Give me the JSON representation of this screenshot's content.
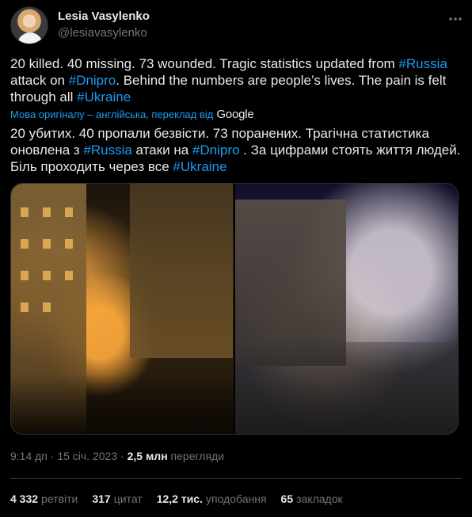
{
  "author": {
    "name": "Lesia Vasylenko",
    "handle": "@lesiavasylenko"
  },
  "tweet": {
    "en_parts": [
      "20 killed. 40 missing. 73 wounded. Tragic statistics updated from ",
      "#Russia",
      " attack on ",
      "#Dnipro",
      ". Behind the numbers are people’s lives. The pain is felt through all ",
      "#Ukraine"
    ],
    "translate_label": "Мова оригіналу – англійська, переклад від",
    "translate_brand": "Google",
    "uk_parts": [
      "20 убитих. 40 пропали безвісти. 73 поранених. Трагічна статистика оновлена з ",
      "#Russia",
      " атаки на ",
      "#Dnipro",
      " . За цифрами стоять життя людей. Біль проходить через все ",
      "#Ukraine"
    ]
  },
  "meta": {
    "time": "9:14 дп",
    "sep": " · ",
    "date": "15 січ. 2023",
    "views_count": "2,5 млн",
    "views_label": "перегляди"
  },
  "stats": {
    "retweets_count": "4 332",
    "retweets_label": "ретвіти",
    "quotes_count": "317",
    "quotes_label": "цитат",
    "likes_count": "12,2 тис.",
    "likes_label": "уподобання",
    "bookmarks_count": "65",
    "bookmarks_label": "закладок"
  },
  "colors": {
    "background": "#000000",
    "text": "#e7e9ea",
    "muted": "#71767b",
    "link": "#1d9bf0",
    "divider": "#2f3336"
  },
  "icons": {
    "more": "more-horizontal-icon"
  }
}
